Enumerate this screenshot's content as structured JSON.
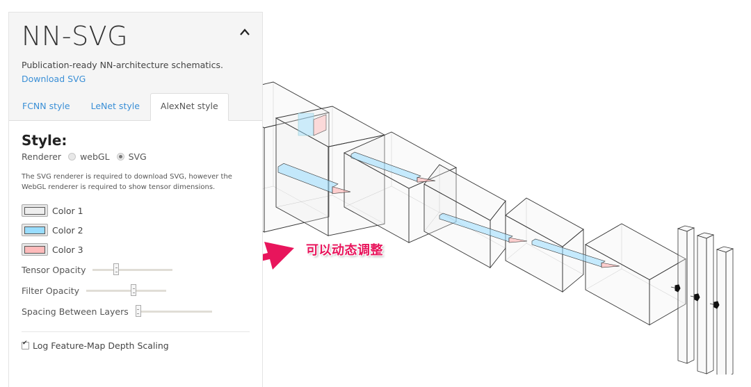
{
  "app": {
    "title": "NN-SVG",
    "subtitle": "Publication-ready NN-architecture schematics.",
    "download_link": "Download SVG",
    "collapse_icon": "chevron-up-icon"
  },
  "tabs": [
    {
      "label": "FCNN style",
      "active": false
    },
    {
      "label": "LeNet style",
      "active": false
    },
    {
      "label": "AlexNet style",
      "active": true
    }
  ],
  "style_section": {
    "heading": "Style:",
    "renderer_label": "Renderer",
    "renderer_options": [
      {
        "label": "webGL",
        "checked": false
      },
      {
        "label": "SVG",
        "checked": true
      }
    ],
    "note": "The SVG renderer is required to download SVG, however the WebGL renderer is required to show tensor dimensions.",
    "colors": [
      {
        "label": "Color 1",
        "value": "#eeeeee"
      },
      {
        "label": "Color 2",
        "value": "#99ddff"
      },
      {
        "label": "Color 3",
        "value": "#ffbbbb"
      }
    ],
    "sliders": [
      {
        "label": "Tensor Opacity",
        "value": 0.28
      },
      {
        "label": "Filter Opacity",
        "value": 0.6
      },
      {
        "label": "Spacing Between Layers",
        "value": 0.0
      }
    ],
    "checkboxes": [
      {
        "label": "Log Feature-Map Depth Scaling",
        "checked": true
      }
    ]
  },
  "annotation": {
    "text": "可以动态调整",
    "color": "#e8155c"
  },
  "diagram": {
    "tensor_color": "#eeeeee",
    "conv_color": "#99ddff",
    "filter_color": "#ffbbbb",
    "layers": [
      "input",
      "conv1",
      "conv2",
      "conv3",
      "conv4",
      "conv5",
      "fc1",
      "fc2",
      "fc3"
    ]
  }
}
